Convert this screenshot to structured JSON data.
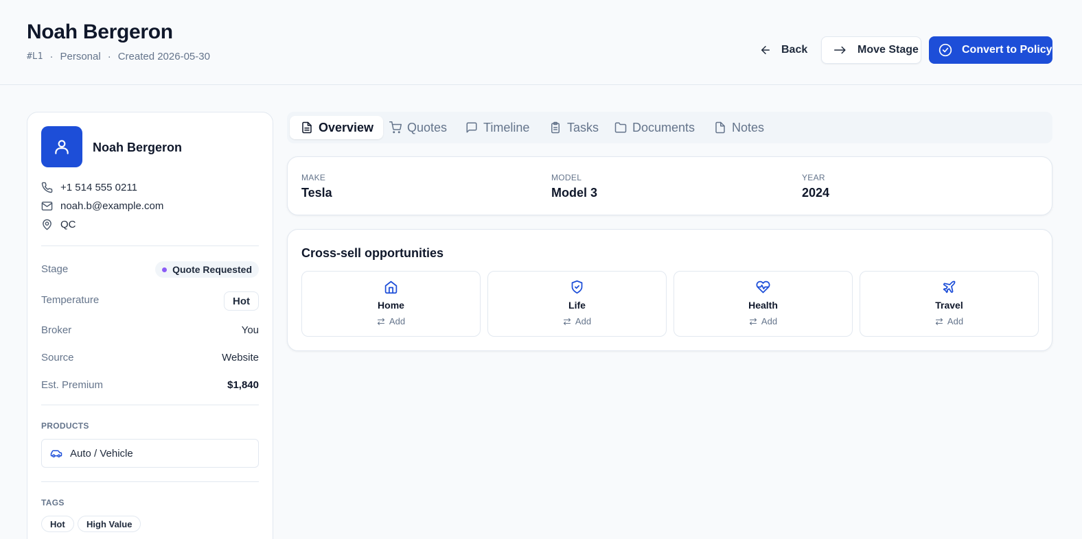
{
  "header": {
    "name": "Noah Bergeron",
    "id": "#L1",
    "type": "Personal",
    "created": "Created 2026-05-30",
    "back_label": "Back",
    "move_label": "Move Stage",
    "convert_label": "Convert to Policy"
  },
  "lead": {
    "name": "Noah Bergeron",
    "phone": "+1 514 555 0211",
    "email": "noah.b@example.com",
    "location": "QC",
    "stage_label": "Stage",
    "stage_value": "Quote Requested",
    "temperature_label": "Temperature",
    "temperature_value": "Hot",
    "broker_label": "Broker",
    "broker_value": "You",
    "source_label": "Source",
    "source_value": "Website",
    "premium_label": "Est. Premium",
    "premium_value": "$1,840",
    "products_caption": "PRODUCTS",
    "product": "Auto / Vehicle",
    "tags_caption": "TAGS",
    "tags": [
      "Hot",
      "High Value"
    ]
  },
  "tabs": [
    {
      "label": "Overview",
      "icon": "file-text-icon"
    },
    {
      "label": "Quotes",
      "icon": "cart-icon"
    },
    {
      "label": "Timeline",
      "icon": "message-square-icon"
    },
    {
      "label": "Tasks",
      "icon": "clipboard-icon"
    },
    {
      "label": "Documents",
      "icon": "folder-icon"
    },
    {
      "label": "Notes",
      "icon": "file-icon"
    }
  ],
  "vehicle": {
    "make_label": "MAKE",
    "make": "Tesla",
    "model_label": "MODEL",
    "model": "Model 3",
    "year_label": "YEAR",
    "year": "2024"
  },
  "cross_sell": {
    "title": "Cross-sell opportunities",
    "items": [
      {
        "name": "Home",
        "action": "Add",
        "icon": "home-icon"
      },
      {
        "name": "Life",
        "action": "Add",
        "icon": "shield-check-icon"
      },
      {
        "name": "Health",
        "action": "Add",
        "icon": "heart-pulse-icon"
      },
      {
        "name": "Travel",
        "action": "Add",
        "icon": "plane-icon"
      }
    ]
  },
  "colors": {
    "primary": "#1d4ed8",
    "stage_dot": "#8b5cf6",
    "background": "#f8fafc"
  }
}
